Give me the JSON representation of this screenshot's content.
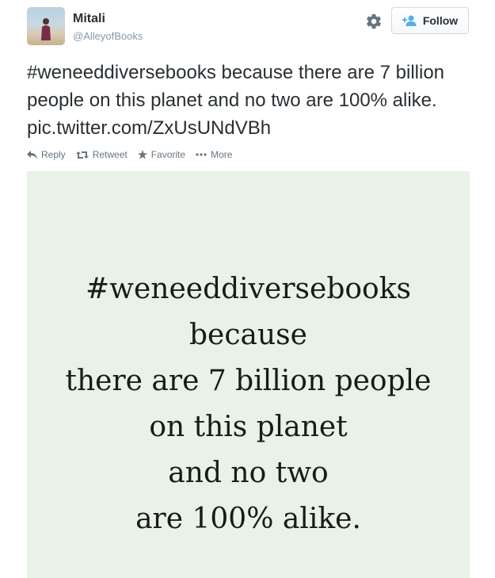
{
  "user": {
    "name": "Mitali",
    "handle": "@AlleyofBooks"
  },
  "icons": {
    "settings": "gear-icon",
    "follow": "add-user-icon",
    "reply": "reply-icon",
    "retweet": "retweet-icon",
    "favorite": "star-icon",
    "more": "ellipsis-icon"
  },
  "follow_button": {
    "label": "Follow"
  },
  "tweet": {
    "text": "#weneeddiversebooks because there are 7 billion people on this planet and no two are 100% alike. pic.twitter.com/ZxUsUNdVBh"
  },
  "actions": {
    "reply": "Reply",
    "retweet": "Retweet",
    "favorite": "Favorite",
    "more": "More"
  },
  "media": {
    "lines": [
      "#weneeddiversebooks",
      "because",
      "there are 7 billion people",
      "on this planet",
      "and no two",
      "are 100% alike."
    ]
  },
  "colors": {
    "text": "#292f33",
    "muted": "#8899a6",
    "action": "#66757f",
    "follow_accent": "#55acee",
    "media_bg": "#e8f2e6"
  }
}
